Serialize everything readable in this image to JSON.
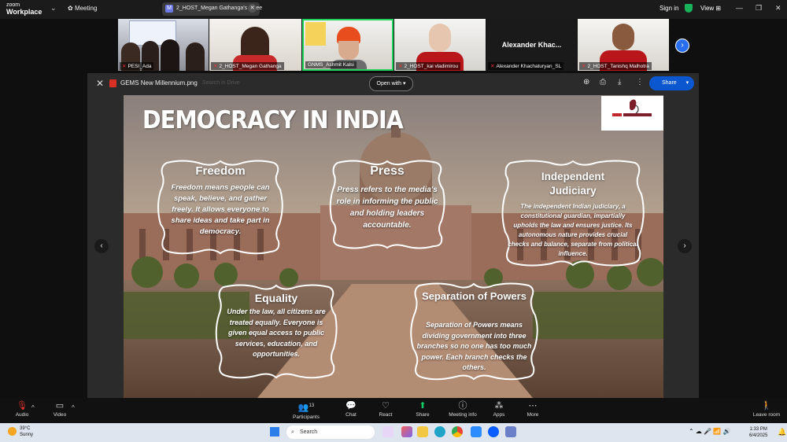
{
  "app": {
    "brand_top": "zoom",
    "brand_bottom": "Workplace",
    "meeting_label": "Meeting",
    "share_tab": "2_HOST_Megan Gathanga's scree",
    "sign_in": "Sign in",
    "view": "View"
  },
  "participants": [
    {
      "name": "PESI_Ada"
    },
    {
      "name": "2_HOST_Megan Gathanga"
    },
    {
      "name": "GNMS_Ashmit Kalsi"
    },
    {
      "name": "2_HOST_kai vladimirou"
    },
    {
      "name": "Alexander Khachaturyan_SL",
      "display": "Alexander  Khac..."
    },
    {
      "name": "2_HOST_Tanishq Malhotra"
    }
  ],
  "viewer": {
    "filename": "GEMS New Millennium.png",
    "open_with": "Open with",
    "share": "Share",
    "ghost_search": "Search in Drive"
  },
  "slide": {
    "title": "DEMOCRACY IN INDIA",
    "logo": "GEMS New Millennium School",
    "cards": [
      {
        "title": "Freedom",
        "body": "Freedom means people can speak, believe, and gather freely. It allows everyone to share ideas and take part in democracy."
      },
      {
        "title": "Press",
        "body": "Press refers to the media's role in informing the public and holding leaders accountable."
      },
      {
        "title": "Independent Judiciary",
        "body": "The independent Indian judiciary, a constitutional guardian, impartially upholds the law and ensures justice. Its autonomous nature provides crucial checks and balance, separate from political influence."
      },
      {
        "title": "Equality",
        "body": "Under the law, all citizens are treated equally. Everyone is given equal access to public services, education, and opportunities."
      },
      {
        "title": "Separation of Powers",
        "body": "Separation of Powers means dividing government into three branches so no one has too much power. Each branch checks the others."
      }
    ]
  },
  "toolbar": {
    "audio": "Audio",
    "video": "Video",
    "participants": "Participants",
    "participants_count": "13",
    "chat": "Chat",
    "react": "React",
    "share": "Share",
    "meeting_info": "Meeting info",
    "apps": "Apps",
    "more": "More",
    "leave": "Leave room"
  },
  "taskbar": {
    "temp": "39°C",
    "weather": "Sunny",
    "search": "Search",
    "time": "1:33 PM",
    "date": "6/4/2025"
  }
}
